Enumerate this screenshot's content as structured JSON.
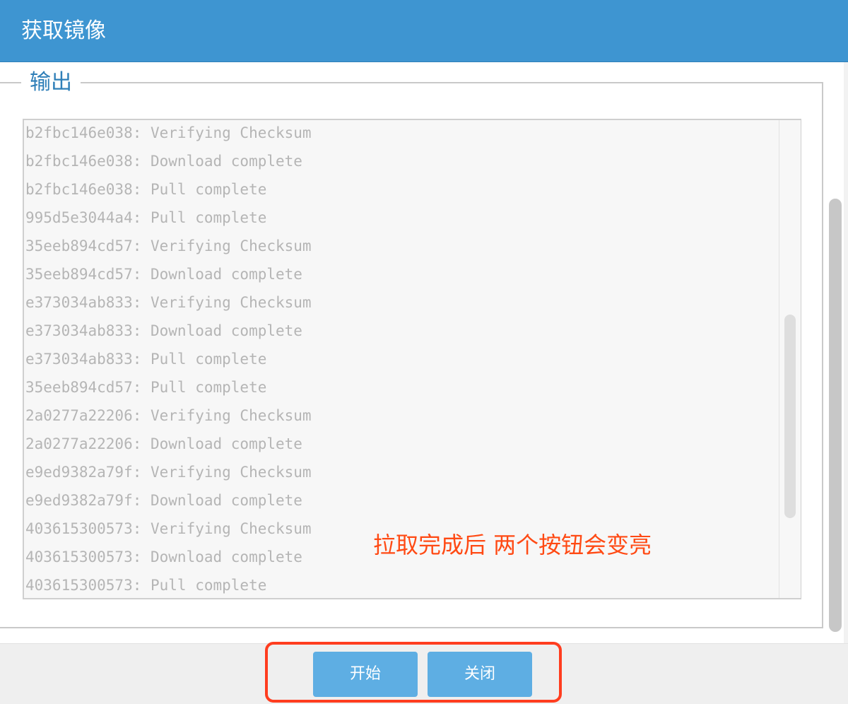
{
  "dialog": {
    "title": "获取镜像"
  },
  "output": {
    "legend": "输出",
    "lines": [
      "b2fbc146e038: Verifying Checksum",
      "b2fbc146e038: Download complete",
      "b2fbc146e038: Pull complete",
      "995d5e3044a4: Pull complete",
      "35eeb894cd57: Verifying Checksum",
      "35eeb894cd57: Download complete",
      "e373034ab833: Verifying Checksum",
      "e373034ab833: Download complete",
      "e373034ab833: Pull complete",
      "35eeb894cd57: Pull complete",
      "2a0277a22206: Verifying Checksum",
      "2a0277a22206: Download complete",
      "e9ed9382a79f: Verifying Checksum",
      "e9ed9382a79f: Download complete",
      "403615300573: Verifying Checksum",
      "403615300573: Download complete",
      "403615300573: Pull complete"
    ]
  },
  "annotation": {
    "text": "拉取完成后 两个按钮会变亮",
    "color": "#ff4a14"
  },
  "buttons": {
    "start_label": "开始",
    "close_label": "关闭"
  },
  "colors": {
    "title_bar": "#3e95d1",
    "button": "#5eaee3",
    "highlight_border": "#ff3d1f",
    "log_text": "#b5b5b5"
  }
}
